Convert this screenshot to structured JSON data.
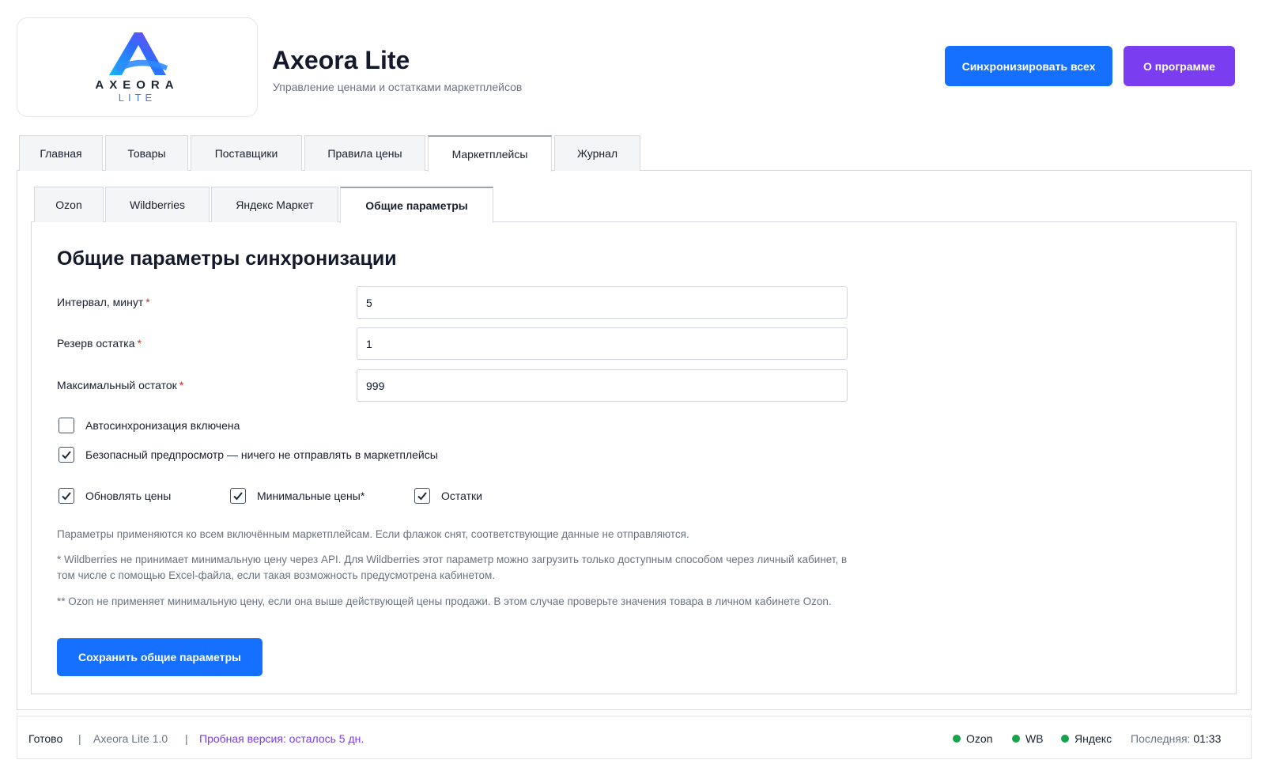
{
  "header": {
    "logo": {
      "wordmark": "AXEORA",
      "sub": "LITE"
    },
    "title": "Axeora Lite",
    "subtitle": "Управление ценами и остатками маркетплейсов",
    "sync_all_label": "Синхронизировать всех",
    "about_label": "О программе",
    "colors": {
      "primary": "#1570ff",
      "purple": "#7a3df0"
    }
  },
  "main_tabs": [
    {
      "label": "Главная",
      "active": false
    },
    {
      "label": "Товары",
      "active": false
    },
    {
      "label": "Поставщики",
      "active": false
    },
    {
      "label": "Правила цены",
      "active": false
    },
    {
      "label": "Маркетплейсы",
      "active": true
    },
    {
      "label": "Журнал",
      "active": false
    }
  ],
  "sub_tabs": [
    {
      "label": "Ozon",
      "active": false
    },
    {
      "label": "Wildberries",
      "active": false
    },
    {
      "label": "Яндекс Маркет",
      "active": false
    },
    {
      "label": "Общие параметры",
      "active": true
    }
  ],
  "form": {
    "title": "Общие параметры синхронизации",
    "fields": [
      {
        "label": "Интервал, минут",
        "required_mark": "*",
        "value": "5"
      },
      {
        "label": "Резерв остатка",
        "required_mark": "*",
        "value": "1"
      },
      {
        "label": "Максимальный остаток",
        "required_mark": "*",
        "value": "999"
      }
    ],
    "checks": {
      "autosync": {
        "label": "Автосинхронизация включена",
        "checked": false
      },
      "safe_preview": {
        "label": "Безопасный предпросмотр — ничего не отправлять в маркетплейсы",
        "checked": true
      },
      "update_prices": {
        "label": "Обновлять цены",
        "checked": true
      },
      "min_prices": {
        "label": "Минимальные цены*",
        "checked": true
      },
      "stocks": {
        "label": "Остатки",
        "checked": true
      }
    },
    "notes": [
      "Параметры применяются ко всем включённым маркетплейсам. Если флажок снят, соответствующие данные не отправляются.",
      "* Wildberries не принимает минимальную цену через API. Для Wildberries этот параметр можно загрузить только доступным способом через личный кабинет, в том числе с помощью Excel-файла, если такая возможность предусмотрена кабинетом.",
      "** Ozon не применяет минимальную цену, если она выше действующей цены продажи. В этом случае проверьте значения товара в личном кабинете Ozon."
    ],
    "save_label": "Сохранить общие параметры"
  },
  "status_bar": {
    "state": "Готово",
    "separator": "|",
    "version": "Axeora Lite 1.0",
    "trial": "Пробная версия: осталось 5 дн.",
    "marketplaces": [
      "Ozon",
      "WB",
      "Яндекс"
    ],
    "last_label": "Последняя:",
    "last_time": "01:33",
    "colors": {
      "online_dot": "#16a34a",
      "trial_text": "#7a3df0"
    }
  }
}
